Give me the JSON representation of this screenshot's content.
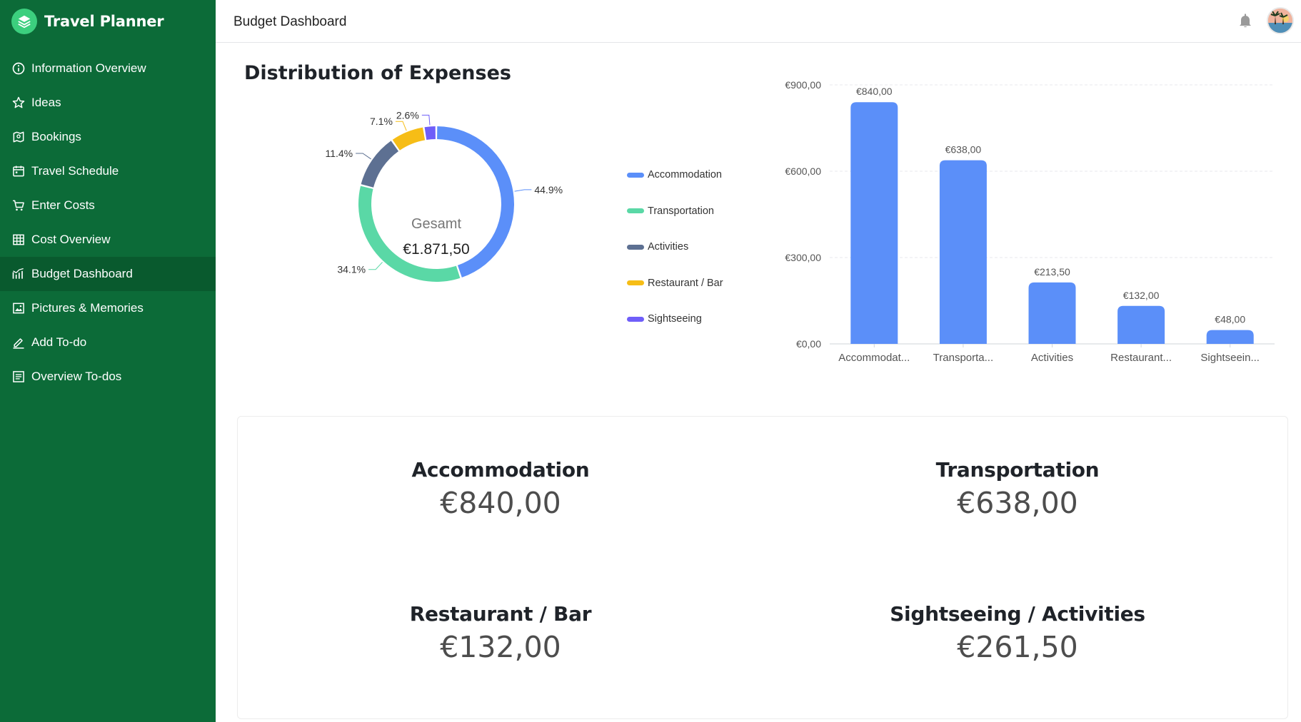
{
  "app": {
    "title": "Travel Planner"
  },
  "sidebar": {
    "items": [
      {
        "label": "Information Overview",
        "icon": "info-icon"
      },
      {
        "label": "Ideas",
        "icon": "star-icon"
      },
      {
        "label": "Bookings",
        "icon": "map-pin-icon"
      },
      {
        "label": "Travel Schedule",
        "icon": "calendar-icon"
      },
      {
        "label": "Enter Costs",
        "icon": "cart-icon"
      },
      {
        "label": "Cost Overview",
        "icon": "table-icon"
      },
      {
        "label": "Budget Dashboard",
        "icon": "bar-chart-icon",
        "active": true
      },
      {
        "label": "Pictures & Memories",
        "icon": "image-icon"
      },
      {
        "label": "Add To-do",
        "icon": "pen-icon"
      },
      {
        "label": "Overview To-dos",
        "icon": "list-icon"
      }
    ]
  },
  "header": {
    "title": "Budget Dashboard"
  },
  "main": {
    "section_title": "Distribution of Expenses"
  },
  "colors": {
    "sidebar_bg": "#0c6b38",
    "accommodation": "#5b8ff9",
    "transportation": "#5ad8a6",
    "activities": "#5d7092",
    "restaurant": "#f6bd16",
    "sightseeing": "#6f5ef9"
  },
  "chart_data": [
    {
      "type": "pie",
      "donut": true,
      "center_label": "Gesamt",
      "center_value": "€1.871,50",
      "slices": [
        {
          "name": "Accommodation",
          "value": 44.9,
          "label": "44.9%",
          "color": "#5b8ff9"
        },
        {
          "name": "Transportation",
          "value": 34.1,
          "label": "34.1%",
          "color": "#5ad8a6"
        },
        {
          "name": "Activities",
          "value": 11.4,
          "label": "11.4%",
          "color": "#5d7092"
        },
        {
          "name": "Restaurant / Bar",
          "value": 7.1,
          "label": "7.1%",
          "color": "#f6bd16"
        },
        {
          "name": "Sightseeing",
          "value": 2.6,
          "label": "2.6%",
          "color": "#6f5ef9"
        }
      ],
      "legend": [
        "Accommodation",
        "Transportation",
        "Activities",
        "Restaurant / Bar",
        "Sightseeing"
      ],
      "legend_position": "right"
    },
    {
      "type": "bar",
      "categories": [
        "Accommodat...",
        "Transporta...",
        "Activities",
        "Restaurant...",
        "Sightseein..."
      ],
      "values": [
        840,
        638,
        213.5,
        132,
        48
      ],
      "value_labels": [
        "€840,00",
        "€638,00",
        "€213,50",
        "€132,00",
        "€48,00"
      ],
      "yticks": [
        "€0,00",
        "€300,00",
        "€600,00",
        "€900,00"
      ],
      "ylim": [
        0,
        900
      ],
      "grid": true,
      "color": "#5b8ff9"
    }
  ],
  "summary": [
    {
      "label": "Accommodation",
      "value": "€840,00"
    },
    {
      "label": "Transportation",
      "value": "€638,00"
    },
    {
      "label": "Restaurant / Bar",
      "value": "€132,00"
    },
    {
      "label": "Sightseeing / Activities",
      "value": "€261,50"
    }
  ]
}
